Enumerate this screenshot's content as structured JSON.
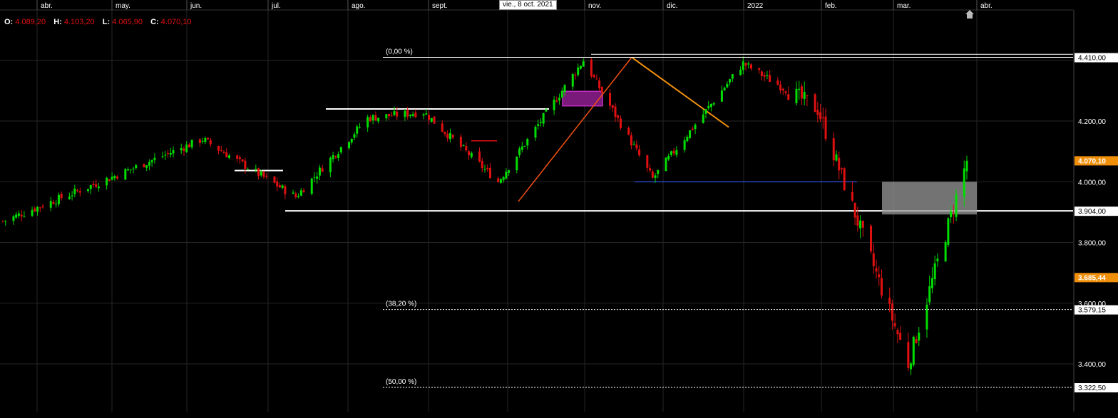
{
  "ohlc": {
    "o_label": "O:",
    "o": "4.089,20",
    "h_label": "H:",
    "h": "4.103,20",
    "l_label": "L:",
    "l": "4.065,90",
    "c_label": "C:",
    "c": "4.070,10"
  },
  "crosshair_date": "vie., 8 oct. 2021",
  "chart_data": {
    "type": "candlestick",
    "x_labels": [
      "abr.",
      "may.",
      "jun.",
      "jul.",
      "ago.",
      "sept.",
      "nov.",
      "dic.",
      "2022",
      "feb.",
      "mar.",
      "abr."
    ],
    "y_ticks": [
      "4.200,00",
      "4.000,00",
      "3.800,00",
      "3.600,00",
      "3.400,00"
    ],
    "y_tick_values": [
      4200,
      4000,
      3800,
      3600,
      3400
    ],
    "ylim": [
      3300,
      4560
    ],
    "price_tags": [
      {
        "label": "4.410,00",
        "value": 4410,
        "style": "white"
      },
      {
        "label": "4.070,10",
        "value": 4070.1,
        "style": "orange"
      },
      {
        "label": "3.904,00",
        "value": 3904,
        "style": "white"
      },
      {
        "label": "3.685,44",
        "value": 3685.44,
        "style": "orange"
      },
      {
        "label": "3.579,15",
        "value": 3579.15,
        "style": "white"
      },
      {
        "label": "3.322,50",
        "value": 3322.5,
        "style": "white"
      }
    ],
    "fibonacci": [
      {
        "label": "(0,00 %)",
        "value": 4410
      },
      {
        "label": "(38,20 %)",
        "value": 3579.15
      },
      {
        "label": "(50,00 %)",
        "value": 3322.5
      }
    ],
    "key_closes": [
      {
        "date": "2021-04-01",
        "close": 3870
      },
      {
        "date": "2021-05-05",
        "close": 3990
      },
      {
        "date": "2021-06-15",
        "close": 4140
      },
      {
        "date": "2021-07-20",
        "close": 3950
      },
      {
        "date": "2021-08-16",
        "close": 4210
      },
      {
        "date": "2021-09-06",
        "close": 4230
      },
      {
        "date": "2021-10-04",
        "close": 4000
      },
      {
        "date": "2021-11-05",
        "close": 4400
      },
      {
        "date": "2021-12-01",
        "close": 4010
      },
      {
        "date": "2022-01-04",
        "close": 4390
      },
      {
        "date": "2022-02-01",
        "close": 4240
      },
      {
        "date": "2022-03-07",
        "close": 3400
      },
      {
        "date": "2022-03-29",
        "close": 4070
      }
    ],
    "colors": {
      "up": "#00dd00",
      "down": "#e01010",
      "background": "#000000",
      "grid": "#2a2a2a",
      "accent": "#f0900a",
      "support": "#3050e0"
    }
  }
}
